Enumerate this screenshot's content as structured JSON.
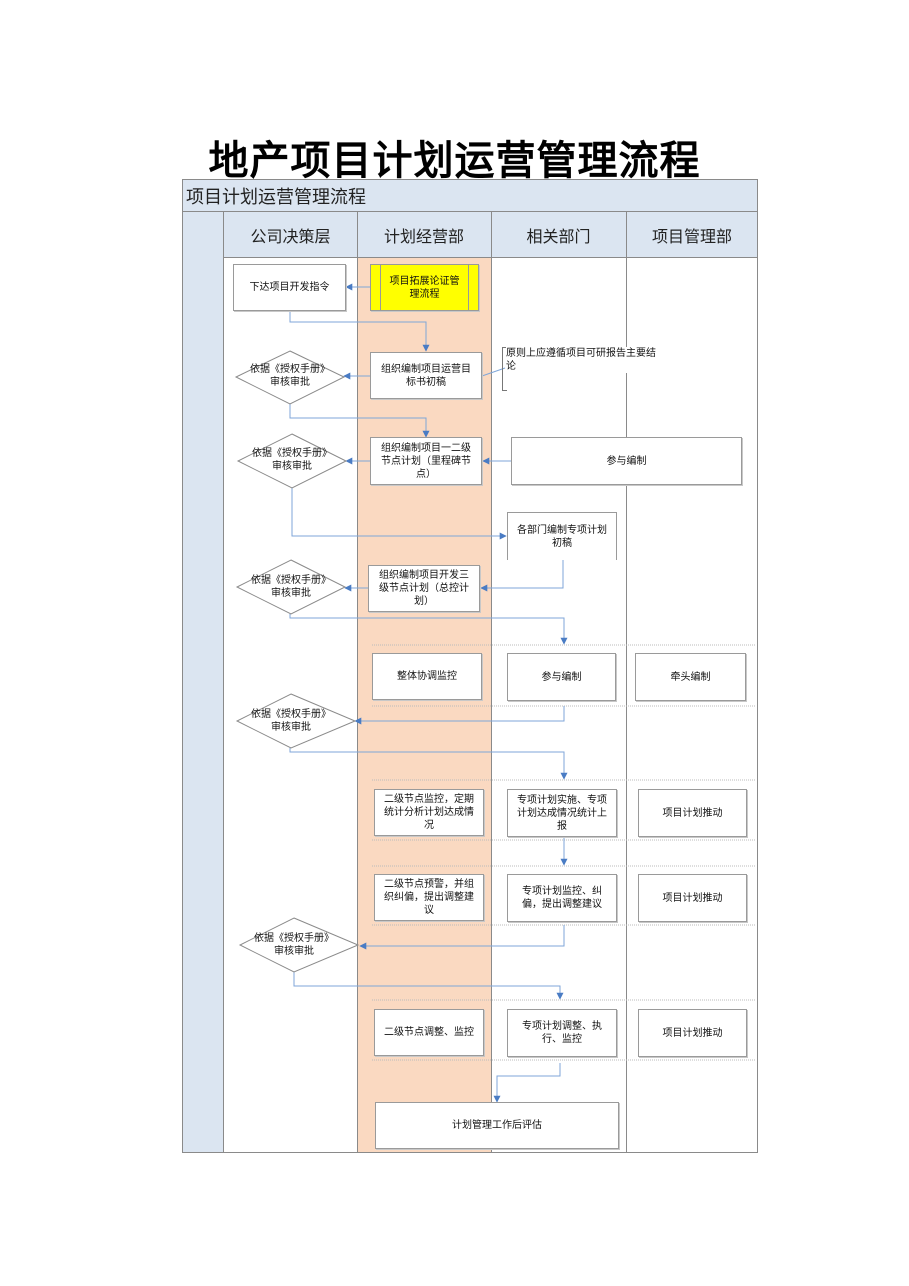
{
  "document": {
    "title": "地产项目计划运营管理流程",
    "header_bar": "项目计划运营管理流程"
  },
  "lanes": [
    {
      "label": "公司决策层"
    },
    {
      "label": "计划经营部"
    },
    {
      "label": "相关部门"
    },
    {
      "label": "项目管理部"
    }
  ],
  "nodes": {
    "dev_instruction": "下达项目开发指令",
    "expansion_flow": "项目拓展论证管理流程",
    "approve_1": "依据《授权手册》审核审批",
    "draft_targets": "组织编制项目运营目标书初稿",
    "note_feasibility": "原则上应遵循项目可研报告主要结论",
    "approve_2": "依据《授权手册》审核审批",
    "milestone_plan": "组织编制项目一二级节点计划（里程碑节点）",
    "participate_1": "参与编制",
    "dept_special_plan": "各部门编制专项计划初稿",
    "approve_3": "依据《授权手册》审核审批",
    "master_plan": "组织编制项目开发三级节点计划（总控计划）",
    "overall_coordination": "整体协调监控",
    "participate_2": "参与编制",
    "lead_compile": "牵头编制",
    "approve_4": "依据《授权手册》审核审批",
    "level2_monitor": "二级节点监控，定期统计分析计划达成情况",
    "special_implement": "专项计划实施、专项计划达成情况统计上报",
    "promote_1": "项目计划推动",
    "level2_warning": "二级节点预警，并组织纠偏，提出调整建议",
    "special_monitor": "专项计划监控、纠偏，提出调整建议",
    "promote_2": "项目计划推动",
    "approve_5": "依据《授权手册》审核审批",
    "level2_adjust": "二级节点调整、监控",
    "special_adjust": "专项计划调整、执行、监控",
    "promote_3": "项目计划推动",
    "post_evaluation": "计划管理工作后评估"
  },
  "colors": {
    "header_fill": "#dbe5f1",
    "planning_lane_fill": "#fad9c1",
    "highlight_box": "#ffff00",
    "connector": "#5b8fd0"
  }
}
